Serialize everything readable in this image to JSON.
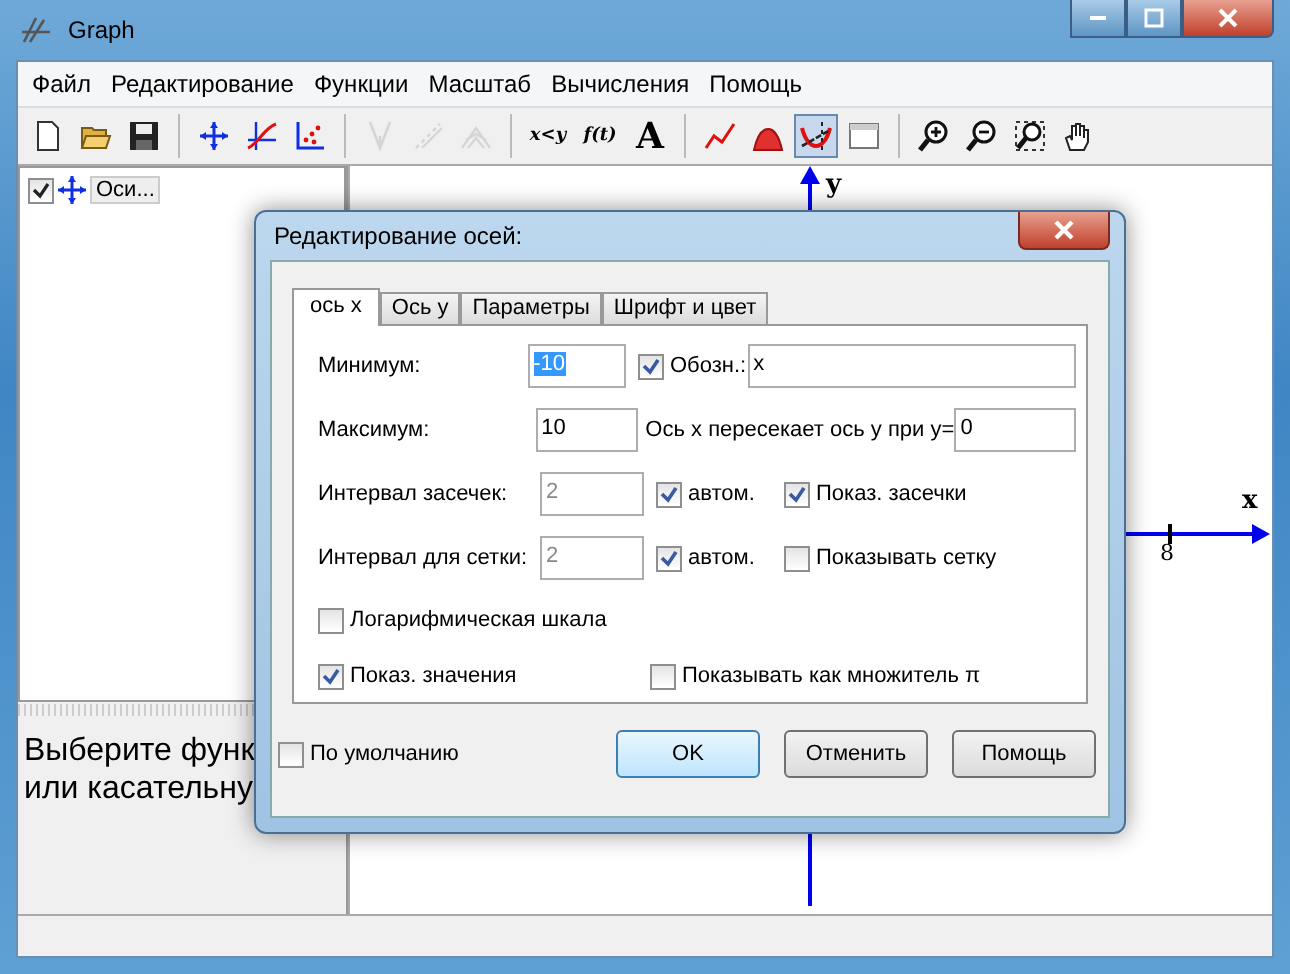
{
  "window": {
    "title": "Graph"
  },
  "menu": [
    "Файл",
    "Редактирование",
    "Функции",
    "Масштаб",
    "Вычисления",
    "Помощь"
  ],
  "toolbar": [
    [
      {
        "disabled": false,
        "pressed": false
      },
      {
        "disabled": false,
        "pressed": false
      },
      {
        "disabled": false,
        "pressed": false
      }
    ],
    [
      {
        "disabled": false,
        "pressed": false
      },
      {
        "disabled": false,
        "pressed": false
      },
      {
        "disabled": false,
        "pressed": false
      }
    ],
    [
      {
        "disabled": true,
        "pressed": false
      },
      {
        "disabled": true,
        "pressed": false
      },
      {
        "disabled": true,
        "pressed": false
      }
    ],
    [
      {
        "label": "x<y",
        "disabled": false,
        "pressed": false
      },
      {
        "label": "f(t)",
        "disabled": false,
        "pressed": false
      },
      {
        "label": "A",
        "disabled": false,
        "pressed": false
      }
    ],
    [
      {
        "disabled": false,
        "pressed": false
      },
      {
        "disabled": false,
        "pressed": false
      },
      {
        "disabled": false,
        "pressed": true
      },
      {
        "disabled": false,
        "pressed": false
      }
    ],
    [
      {
        "disabled": false,
        "pressed": false
      },
      {
        "disabled": false,
        "pressed": false
      },
      {
        "disabled": false,
        "pressed": false
      },
      {
        "disabled": false,
        "pressed": false
      }
    ]
  ],
  "tree": [
    {
      "label": "Оси...",
      "checked": true
    }
  ],
  "hint": [
    "Выберите функ",
    "или касательну"
  ],
  "canvas": {
    "y_label": "y",
    "x_label": "x",
    "x_tick": "8"
  },
  "dialog": {
    "title": "Редактирование осей:",
    "tabs": [
      {
        "label": "ось x",
        "selected": true
      },
      {
        "label": "Ось y",
        "selected": false
      },
      {
        "label": "Параметры",
        "selected": false
      },
      {
        "label": "Шрифт и цвет",
        "selected": false
      }
    ],
    "rows": [
      {
        "label": "Минимум:",
        "field": {
          "value": "-10",
          "disabled": false,
          "text_selected": true
        },
        "items": [
          {
            "kind": "checkbox",
            "label": "Обозн.:",
            "checked": true
          },
          {
            "kind": "field",
            "value": "x"
          }
        ]
      },
      {
        "label": "Максимум:",
        "field": {
          "value": "10",
          "disabled": false,
          "text_selected": false
        },
        "items": [
          {
            "kind": "text",
            "label": "Ось x пересекает ось y при y="
          },
          {
            "kind": "field",
            "value": "0"
          }
        ]
      },
      {
        "label": "Интервал засечек:",
        "field": {
          "value": "2",
          "disabled": true,
          "text_selected": false
        },
        "items": [
          {
            "kind": "checkbox",
            "label": "автом.",
            "checked": true
          },
          {
            "kind": "checkbox",
            "label": "Показ. засечки",
            "checked": true
          }
        ]
      },
      {
        "label": "Интервал для сетки:",
        "field": {
          "value": "2",
          "disabled": true,
          "text_selected": false
        },
        "items": [
          {
            "kind": "checkbox",
            "label": "автом.",
            "checked": true
          },
          {
            "kind": "checkbox",
            "label": "Показывать сетку",
            "checked": false
          }
        ]
      }
    ],
    "options": [
      [
        {
          "label": "Логарифмическая шкала",
          "checked": false
        }
      ],
      [
        {
          "label": "Показ. значения",
          "checked": true
        },
        {
          "label": "Показывать как множитель π",
          "checked": false
        }
      ]
    ],
    "default": {
      "label": "По умолчанию",
      "checked": false
    },
    "buttons": [
      {
        "label": "OK",
        "default": true
      },
      {
        "label": "Отменить",
        "default": false
      },
      {
        "label": "Помощь",
        "default": false
      }
    ]
  }
}
